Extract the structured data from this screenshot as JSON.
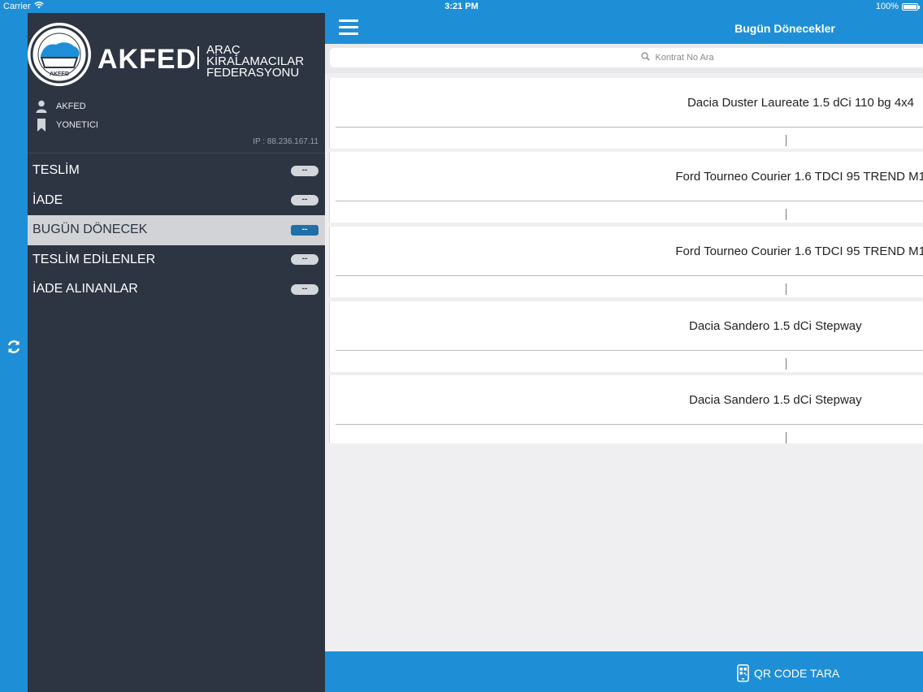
{
  "status_bar": {
    "carrier": "Carrier",
    "time": "3:21 PM",
    "battery": "100%"
  },
  "sidebar": {
    "brand": "AKFED",
    "brand_sub_line1": "ARAÇ KİRALAMACILAR",
    "brand_sub_line2": "FEDERASYONU",
    "emblem_text": "AKFED",
    "user_name": "AKFED",
    "user_role": "YONETICI",
    "ip": "IP : 88.236.167.11",
    "menu": [
      {
        "label": "TESLİM",
        "badge": "--"
      },
      {
        "label": "İADE",
        "badge": "--"
      },
      {
        "label": "BUGÜN DÖNECEK",
        "badge": "--",
        "active": true
      },
      {
        "label": "TESLİM EDİLENLER",
        "badge": "--"
      },
      {
        "label": "İADE ALINANLAR",
        "badge": "--"
      }
    ]
  },
  "main": {
    "title": "Bugün Dönecekler",
    "search_placeholder": "Kontrat No Ara",
    "cars": [
      "Dacia Duster Laureate 1.5 dCi 110 bg 4x4",
      "Ford Tourneo Courier 1.6 TDCI 95 TREND M1",
      "Ford Tourneo Courier 1.6 TDCI 95 TREND M1",
      "Dacia Sandero 1.5 dCi  Stepway",
      "Dacia Sandero 1.5 dCi  Stepway"
    ],
    "qr_label": "QR CODE TARA"
  },
  "colors": {
    "accent_blue": "#1e8fd6",
    "sidebar_bg": "#2d3442",
    "active_item_bg": "#d1d3d6",
    "active_badge": "#1f6fa8"
  }
}
